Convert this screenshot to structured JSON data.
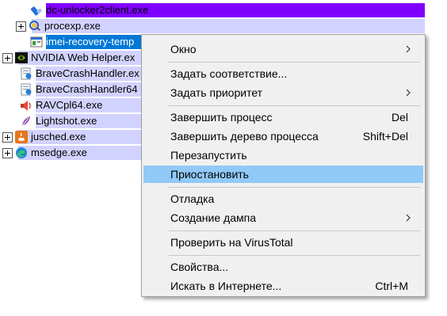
{
  "processes": [
    {
      "name": "dc-unlocker2client.exe",
      "icon": "usb-drive-icon",
      "bg": "#8000ff"
    },
    {
      "name": "procexp.exe",
      "icon": "process-explorer-icon",
      "bg": "#d2d2ff"
    },
    {
      "name": "imei-recovery-temp",
      "icon": "generic-exe-icon",
      "bg": "#0078d7",
      "selected": true
    },
    {
      "name": "NVIDIA Web Helper.ex",
      "icon": "nvidia-icon",
      "bg": "#d2d2ff"
    },
    {
      "name": "BraveCrashHandler.ex",
      "icon": "brave-crash-icon",
      "bg": "#d2d2ff"
    },
    {
      "name": "BraveCrashHandler64",
      "icon": "brave-crash-icon",
      "bg": "#d2d2ff"
    },
    {
      "name": "RAVCpl64.exe",
      "icon": "speaker-icon",
      "bg": "#d2d2ff"
    },
    {
      "name": "Lightshot.exe",
      "icon": "lightshot-feather-icon",
      "bg": "#d2d2ff"
    },
    {
      "name": "jusched.exe",
      "icon": "java-icon",
      "bg": "#d2d2ff"
    },
    {
      "name": "msedge.exe",
      "icon": "edge-icon",
      "bg": "#d2d2ff"
    }
  ],
  "menu": {
    "items": [
      {
        "label": "Окно",
        "submenu": true
      },
      {
        "label": "Задать соответствие..."
      },
      {
        "label": "Задать приоритет",
        "submenu": true
      },
      {
        "label": "Завершить процесс",
        "shortcut": "Del"
      },
      {
        "label": "Завершить дерево процесса",
        "shortcut": "Shift+Del"
      },
      {
        "label": "Перезапустить"
      },
      {
        "label": "Приостановить",
        "highlighted": true
      },
      {
        "label": "Отладка"
      },
      {
        "label": "Создание дампа",
        "submenu": true
      },
      {
        "label": "Проверить на VirusTotal"
      },
      {
        "label": "Свойства..."
      },
      {
        "label": "Искать в Интернете...",
        "shortcut": "Ctrl+M"
      }
    ]
  },
  "colors": {
    "highlight": "#91c9f7",
    "selection": "#0078d7",
    "suspended_purple": "#8000ff",
    "own_process_lavender": "#d2d2ff"
  }
}
